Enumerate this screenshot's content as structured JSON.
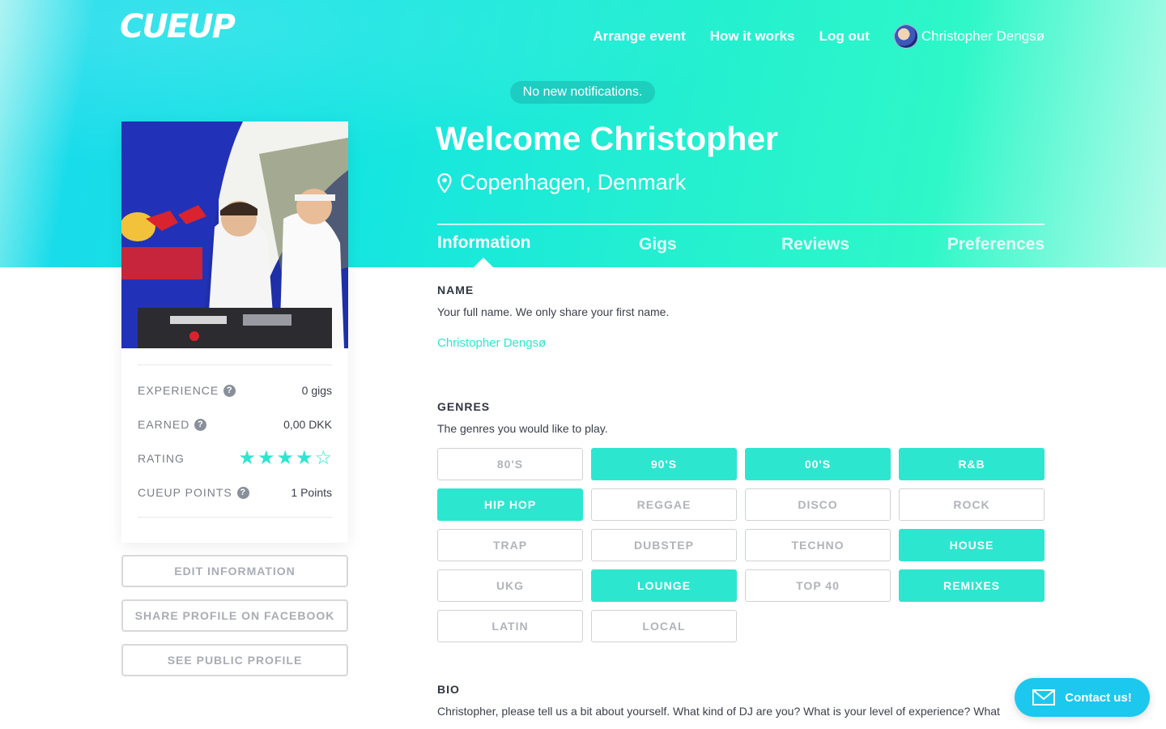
{
  "brand": {
    "logo": "CUEUP"
  },
  "nav": {
    "arrange_event": "Arrange event",
    "how_it_works": "How it works",
    "log_out": "Log out",
    "user_name": "Christopher Dengsø"
  },
  "notification": "No new notifications.",
  "header": {
    "welcome": "Welcome Christopher",
    "location": "Copenhagen, Denmark"
  },
  "tabs": [
    {
      "label": "Information",
      "active": true
    },
    {
      "label": "Gigs",
      "active": false
    },
    {
      "label": "Reviews",
      "active": false
    },
    {
      "label": "Preferences",
      "active": false
    }
  ],
  "stats": {
    "experience_label": "EXPERIENCE",
    "experience_value": "0 gigs",
    "earned_label": "EARNED",
    "earned_value": "0,00 DKK",
    "rating_label": "RATING",
    "rating_value": 4,
    "rating_max": 5,
    "points_label": "CUEUP POINTS",
    "points_value": "1 Points"
  },
  "side_buttons": {
    "edit": "EDIT INFORMATION",
    "share": "SHARE PROFILE ON FACEBOOK",
    "public": "SEE PUBLIC PROFILE"
  },
  "name_section": {
    "title": "NAME",
    "desc": "Your full name. We only share your first name.",
    "value": "Christopher Dengsø"
  },
  "genres_section": {
    "title": "GENRES",
    "desc": "The genres you would like to play.",
    "items": [
      {
        "label": "80'S",
        "selected": false
      },
      {
        "label": "90'S",
        "selected": true
      },
      {
        "label": "00'S",
        "selected": true
      },
      {
        "label": "R&B",
        "selected": true
      },
      {
        "label": "HIP HOP",
        "selected": true
      },
      {
        "label": "REGGAE",
        "selected": false
      },
      {
        "label": "DISCO",
        "selected": false
      },
      {
        "label": "ROCK",
        "selected": false
      },
      {
        "label": "TRAP",
        "selected": false
      },
      {
        "label": "DUBSTEP",
        "selected": false
      },
      {
        "label": "TECHNO",
        "selected": false
      },
      {
        "label": "HOUSE",
        "selected": true
      },
      {
        "label": "UKG",
        "selected": false
      },
      {
        "label": "LOUNGE",
        "selected": true
      },
      {
        "label": "TOP 40",
        "selected": false
      },
      {
        "label": "REMIXES",
        "selected": true
      },
      {
        "label": "LATIN",
        "selected": false
      },
      {
        "label": "LOCAL",
        "selected": false
      }
    ]
  },
  "bio_section": {
    "title": "BIO",
    "desc": "Christopher, please tell us a bit about yourself. What kind of DJ are you? What is your level of experience? What"
  },
  "contact": {
    "label": "Contact us!"
  },
  "colors": {
    "accent": "#2de6cf",
    "contact": "#1dc8ee"
  }
}
